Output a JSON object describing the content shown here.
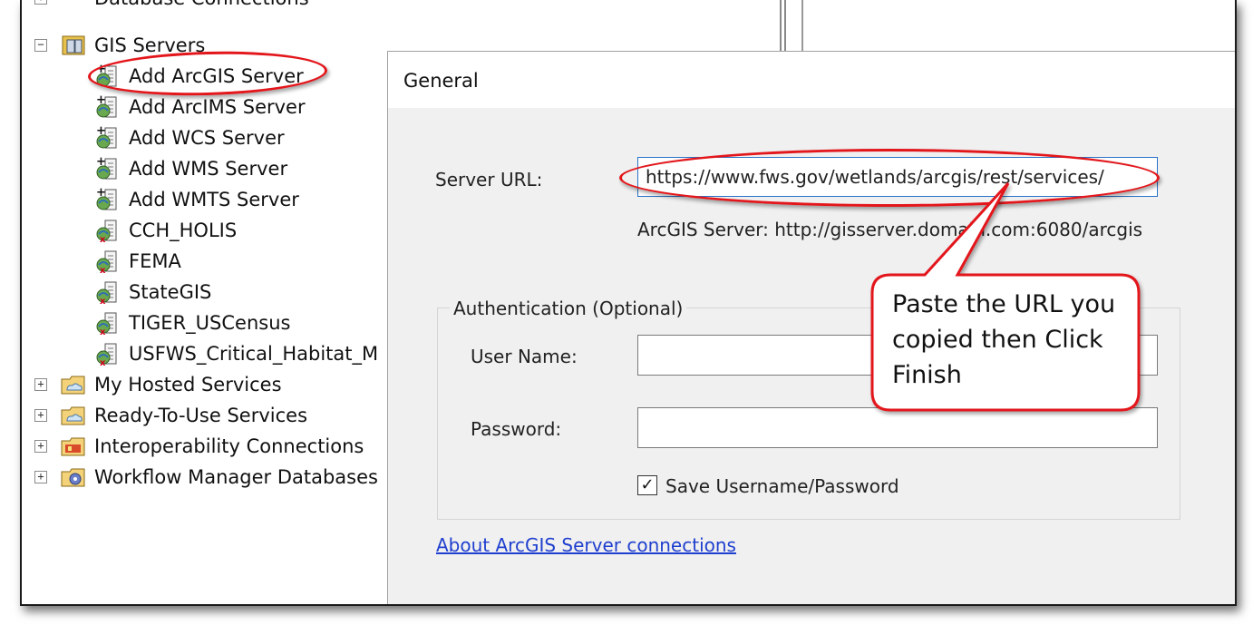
{
  "tree": {
    "cutoff_item": "Database Connections",
    "gis_servers": {
      "label": "GIS Servers",
      "expand_symbol": "−",
      "children": [
        "Add ArcGIS Server",
        "Add ArcIMS Server",
        "Add WCS Server",
        "Add WMS Server",
        "Add WMTS Server",
        "CCH_HOLIS",
        "FEMA",
        "StateGIS",
        "TIGER_USCensus",
        "USFWS_Critical_Habitat_M"
      ]
    },
    "roots": [
      {
        "label": "My Hosted Services",
        "expand_symbol": "+",
        "icon": "folder-cloud-icon"
      },
      {
        "label": "Ready-To-Use Services",
        "expand_symbol": "+",
        "icon": "folder-cloud-icon"
      },
      {
        "label": "Interoperability Connections",
        "expand_symbol": "+",
        "icon": "interop-folder-icon"
      },
      {
        "label": "Workflow Manager Databases",
        "expand_symbol": "+",
        "icon": "workflow-db-icon"
      }
    ]
  },
  "dialog": {
    "title": "General",
    "server_url_label": "Server URL:",
    "server_url_value": "https://www.fws.gov/wetlands/arcgis/rest/services/",
    "server_url_hint": "ArcGIS Server: http://gisserver.domain.com:6080/arcgis",
    "auth_group_label": "Authentication (Optional)",
    "username_label": "User Name:",
    "username_value": "",
    "password_label": "Password:",
    "password_value": "",
    "save_checkbox_label": "Save Username/Password",
    "save_checked": true,
    "check_mark": "✓",
    "help_link": "About ArcGIS Server connections"
  },
  "annotation": {
    "callout_lines": [
      "Paste the URL you",
      "copied then Click",
      "Finish"
    ],
    "highlight_color": "#e3161b"
  }
}
